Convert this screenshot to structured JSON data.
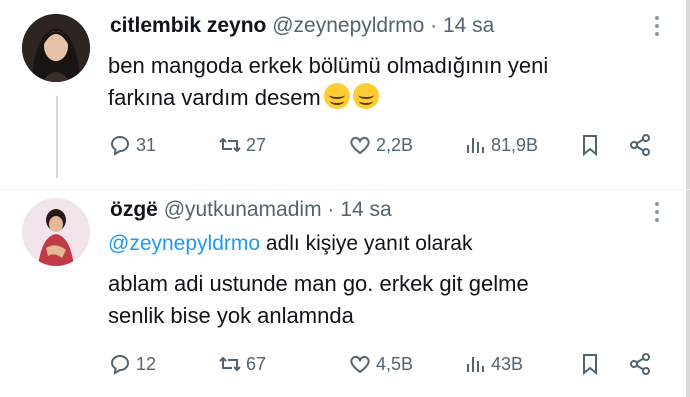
{
  "tweets": [
    {
      "name": "citlembik zeyno",
      "handle": "@zeynepyldrmo",
      "separator": "·",
      "time": "14 sa",
      "text_line1": "ben mangoda erkek bölümü olmadığının yeni",
      "text_line2": "farkına vardım desem",
      "emojis": [
        "smiling-face-icon",
        "smiling-face-icon"
      ],
      "stats": {
        "replies": "31",
        "retweets": "27",
        "likes": "2,2B",
        "views": "81,9B"
      }
    },
    {
      "name": "özgë",
      "handle": "@yutkunamadim",
      "separator": "·",
      "time": "14 sa",
      "reply_to_handle": "@zeynepyldrmo",
      "reply_to_suffix": "adlı kişiye yanıt olarak",
      "text_line1": "ablam adi ustunde man go. erkek git gelme",
      "text_line2": "senlik bise yok anlamnda",
      "stats": {
        "replies": "12",
        "retweets": "67",
        "likes": "4,5B",
        "views": "43B"
      }
    }
  ],
  "colors": {
    "link": "#1d9bf0",
    "muted": "#536471",
    "text": "#0f1419",
    "thread_line": "#cfd9de"
  }
}
